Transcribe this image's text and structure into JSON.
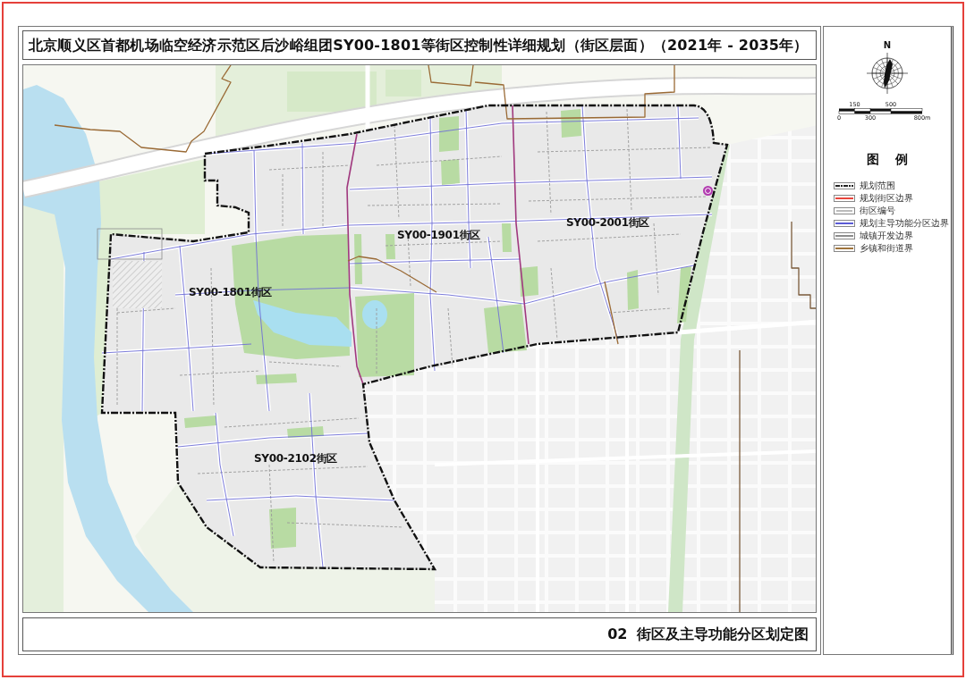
{
  "title": "北京顺义区首都机场临空经济示范区后沙峪组团SY00-1801等街区控制性详细规划（街区层面）（2021年 - 2035年）",
  "map": {
    "district_labels": [
      "SY00-1801街区",
      "SY00-1901街区",
      "SY00-2001街区",
      "SY00-2102街区"
    ]
  },
  "caption": "02 街区及主导功能分区划定图",
  "north_arrow": {
    "label": "N"
  },
  "scale_bar": {
    "labels": [
      "0",
      "150",
      "300",
      "500",
      "800m"
    ]
  },
  "legend": {
    "title": "图 例",
    "items": [
      {
        "label": "规划范围",
        "kind": "dashed",
        "color": "#222222"
      },
      {
        "label": "规划街区边界",
        "kind": "line",
        "color": "#e8453c"
      },
      {
        "label": "街区编号",
        "kind": "tag",
        "color": "#bbbbbb"
      },
      {
        "label": "规划主导功能分区边界",
        "kind": "line",
        "color": "#5b5bd6"
      },
      {
        "label": "城镇开发边界",
        "kind": "line",
        "color": "#8c8c8c"
      },
      {
        "label": "乡镇和街道界",
        "kind": "line",
        "color": "#a0743c"
      }
    ]
  }
}
